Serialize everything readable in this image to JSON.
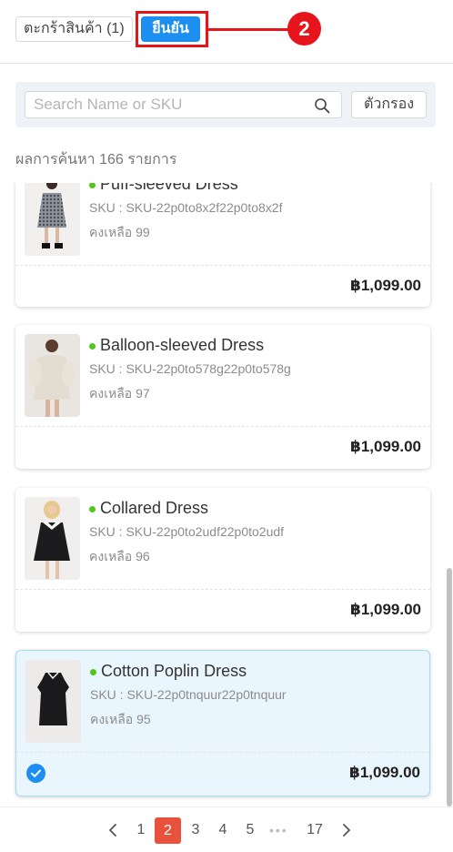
{
  "header": {
    "cart_label": "ตะกร้าสินค้า (1)",
    "confirm_label": "ยืนยัน",
    "callout_number": "2"
  },
  "search": {
    "placeholder": "Search Name or SKU",
    "value": "",
    "filter_label": "ตัวกรอง"
  },
  "results": {
    "count_text": "ผลการค้นหา 166 รายการ"
  },
  "products": [
    {
      "name": "Puff-sleeved Dress",
      "sku": "SKU : SKU-22p0to8x2f22p0to8x2f",
      "stock": "คงเหลือ 99",
      "price": "฿1,099.00",
      "status_color": "#52c41a",
      "selected": false,
      "image_icon": "patterned-dress-photo"
    },
    {
      "name": "Balloon-sleeved Dress",
      "sku": "SKU : SKU-22p0to578g22p0to578g",
      "stock": "คงเหลือ 97",
      "price": "฿1,099.00",
      "status_color": "#52c41a",
      "selected": false,
      "image_icon": "cream-dress-photo"
    },
    {
      "name": "Collared Dress",
      "sku": "SKU : SKU-22p0to2udf22p0to2udf",
      "stock": "คงเหลือ 96",
      "price": "฿1,099.00",
      "status_color": "#52c41a",
      "selected": false,
      "image_icon": "black-collared-dress-photo"
    },
    {
      "name": "Cotton Poplin Dress",
      "sku": "SKU : SKU-22p0tnquur22p0tnquur",
      "stock": "คงเหลือ 95",
      "price": "฿1,099.00",
      "status_color": "#52c41a",
      "selected": true,
      "image_icon": "black-poplin-dress-photo"
    }
  ],
  "pagination": {
    "prev_icon": "chevron-left-icon",
    "pages": [
      "1",
      "2",
      "3",
      "4",
      "5"
    ],
    "current": "2",
    "ellipsis": "•••",
    "last": "17",
    "next_icon": "chevron-right-icon"
  },
  "colors": {
    "primary": "#1d8ff0",
    "callout_red": "#e8141c",
    "active_page": "#e8513c",
    "in_stock": "#52c41a"
  }
}
